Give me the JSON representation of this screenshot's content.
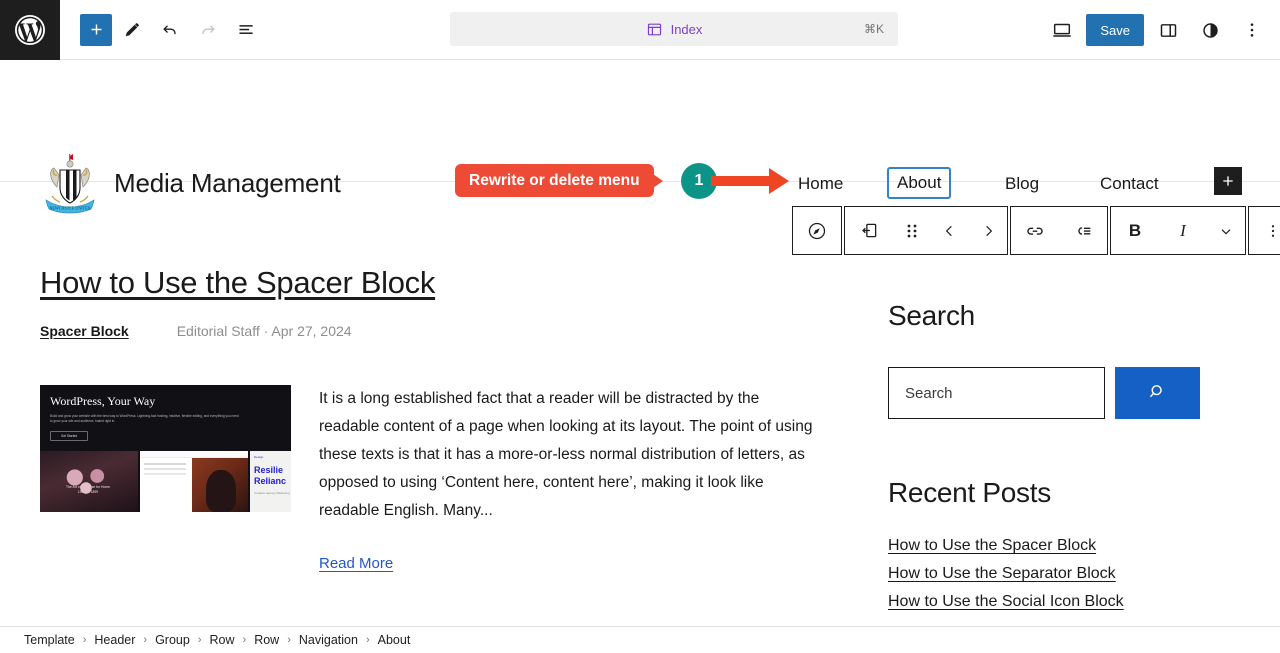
{
  "topbar": {
    "logo_icon": "wordpress-logo-icon",
    "tools": [
      {
        "name": "add-block-button",
        "icon": "plus-icon",
        "label": "+"
      },
      {
        "name": "edit-mode-button",
        "icon": "pencil-icon",
        "label": ""
      },
      {
        "name": "undo-button",
        "icon": "undo-arrow-icon",
        "label": ""
      },
      {
        "name": "redo-button",
        "icon": "redo-arrow-icon",
        "label": ""
      },
      {
        "name": "document-overview-button",
        "icon": "list-view-icon",
        "label": ""
      }
    ],
    "document_chip": {
      "icon": "template-index-icon",
      "label": "Index",
      "shortcut": "⌘K"
    },
    "view_icon": "desktop-preview-icon",
    "save_label": "Save",
    "settings_icon": "settings-sidebar-icon",
    "styles_icon": "contrast-styles-icon",
    "options_icon": "kebab-menu-icon",
    "accent_blue": "#2271b1",
    "chip_purple": "#7b42c9"
  },
  "site": {
    "logo_icon": "newcastle-united-crest-icon",
    "title": "Media Management",
    "nav": [
      {
        "label": "Home",
        "selected": false
      },
      {
        "label": "About",
        "selected": true
      },
      {
        "label": "Blog",
        "selected": false
      },
      {
        "label": "Contact",
        "selected": false
      }
    ],
    "add_nav_item_label": "+",
    "selection_color": "#3582c4"
  },
  "block_toolbar": {
    "groups": [
      {
        "items": [
          {
            "name": "block-type-navigation-icon",
            "label": ""
          }
        ]
      },
      {
        "items": [
          {
            "name": "block-type-page-link-icon",
            "label": ""
          },
          {
            "name": "drag-handle-icon",
            "label": ""
          },
          {
            "name": "move-left-icon",
            "label": ""
          },
          {
            "name": "move-right-icon",
            "label": ""
          }
        ]
      },
      {
        "items": [
          {
            "name": "link-icon",
            "label": ""
          },
          {
            "name": "submenu-icon",
            "label": ""
          }
        ]
      },
      {
        "items": [
          {
            "name": "bold-icon",
            "label": "B"
          },
          {
            "name": "italic-icon",
            "label": "I"
          },
          {
            "name": "more-formatting-chevron-icon",
            "label": ""
          }
        ]
      },
      {
        "items": [
          {
            "name": "block-options-kebab-icon",
            "label": ""
          }
        ]
      }
    ]
  },
  "post": {
    "title": "How to Use the Spacer Block",
    "category": "Spacer Block",
    "byline": "Editorial Staff · Apr 27, 2024",
    "featured_image": {
      "name": "featured-image-wordpress-your-way",
      "hero_title": "WordPress, Your Way",
      "hero_paragraph": "Build and grow your website with the best way to WordPress: Lightning-fast hosting, intuitive, flexible editing, and everything you need to grow your site and audience, baked right in.",
      "hero_button": "Get Started",
      "pane1_caption": "The Art of the Rose for Home 1870 — 1899",
      "pane3_kicker": "Design",
      "pane3_title": "Resilie Relianc",
      "pane3_sub": "Creative agency Marketing"
    },
    "excerpt": "It is a long established fact that a reader will be distracted by the readable content of a page when looking at its layout. The point of using these texts is that it has a more-or-less normal distribution of letters, as opposed to using ‘Content here, content here’, making it look like readable English. Many...",
    "read_more": "Read More"
  },
  "sidebar": {
    "search": {
      "title": "Search",
      "placeholder": "Search",
      "value": "",
      "button_icon": "search-magnifier-icon",
      "button_color": "#1560c4"
    },
    "recent_posts": {
      "title": "Recent Posts",
      "items": [
        "How to Use the Spacer Block",
        "How to Use the Separator Block",
        "How to Use the Social Icon Block"
      ]
    }
  },
  "annotation": {
    "label": "Rewrite or delete menu",
    "step_number": "1",
    "label_color": "#ee4b37",
    "badge_color": "#0d9488",
    "arrow_color": "#ef4523"
  },
  "breadcrumb": {
    "separator": "›",
    "items": [
      "Template",
      "Header",
      "Group",
      "Row",
      "Row",
      "Navigation",
      "About"
    ]
  }
}
